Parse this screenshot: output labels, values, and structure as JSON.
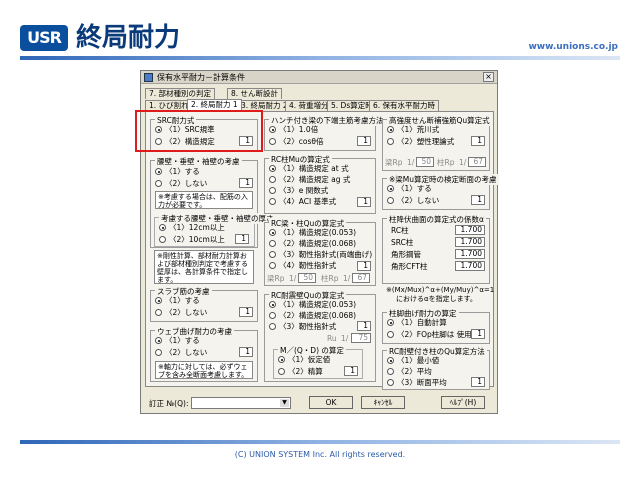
{
  "header": {
    "logo": "USR",
    "title": "終局耐力",
    "site": "www.unions.co.jp"
  },
  "footer": {
    "copyright": "(C) UNION SYSTEM Inc. All rights reserved."
  },
  "window": {
    "title": "保有水平耐力－計算条件",
    "close": "×"
  },
  "tabs_row1": [
    "7. 部材種別の判定",
    "8. せん断設計"
  ],
  "tabs_row2": [
    "1. ひび割れ",
    "2. 終局耐力 1",
    "3. 終局耐力 2",
    "4. 荷重増分",
    "5. Ds算定時",
    "6. 保有水平耐力時"
  ],
  "src": {
    "label": "SRC耐力式",
    "opt1": "〈1〉SRC規準",
    "opt2": "〈2〉構造規定",
    "val": "1"
  },
  "wall": {
    "label": "腰壁・垂壁・袖壁の考慮",
    "opt1": "〈1〉する",
    "opt2": "〈2〉しない",
    "val": "1",
    "note": "※考慮する場合は、配筋の入力が必要です。"
  },
  "thick": {
    "label": "考慮する腰壁・垂壁・袖壁の厚さ",
    "opt1": "〈1〉12cm以上",
    "opt2": "〈2〉10cm以上",
    "val": "1",
    "note": "※剛性計算、部材耐力計算および部材種別判定で考慮する壁厚は、各計算条件で指定します。"
  },
  "slab": {
    "label": "スラブ筋の考慮",
    "opt1": "〈1〉する",
    "opt2": "〈2〉しない",
    "val": "1"
  },
  "web": {
    "label": "ウェブ曲げ耐力の考慮",
    "opt1": "〈1〉する",
    "opt2": "〈2〉しない",
    "val": "1",
    "note": "※軸力に対しては、必ずウェブを含み全断面考慮します。"
  },
  "haunch": {
    "label": "ハンチ付き梁の下端主筋考慮方法",
    "opt1": "〈1〉1.0倍",
    "opt2": "〈2〉cosθ倍",
    "val": "1"
  },
  "rcmu": {
    "label": "RC柱Muの算定式",
    "opts": [
      "〈1〉構造規定 at 式",
      "〈2〉構造規定 ag 式",
      "〈3〉e 関数式",
      "〈4〉ACI 基準式"
    ],
    "val": "1"
  },
  "rcqu": {
    "label": "RC梁・柱Quの算定式",
    "opts": [
      "〈1〉構造規定(0.053)",
      "〈2〉構造規定(0.068)",
      "〈3〉靭性指針式(両端曲げ)",
      "〈4〉靭性指針式"
    ],
    "val": "1",
    "rp_label": "梁Rp",
    "rp": "50",
    "col_label": "柱Rp",
    "col": "67"
  },
  "rcwall": {
    "label": "RC耐震壁Quの算定式",
    "opts": [
      "〈1〉構造規定(0.053)",
      "〈2〉構造規定(0.068)",
      "〈3〉靭性指針式"
    ],
    "val": "1",
    "ru_label": "Ru",
    "ru": "75"
  },
  "mqd": {
    "label": "M／(Q・D) の算定",
    "opt1": "〈1〉仮定値",
    "opt2": "〈2〉精算",
    "val": "1"
  },
  "shear": {
    "label": "高強度せん断補強筋Qu算定式",
    "opt1": "〈1〉荒川式",
    "opt2": "〈2〉塑性理論式",
    "val": "1",
    "rp_label": "梁Rp",
    "rp": "50",
    "col_label": "柱Rp",
    "col": "67"
  },
  "mu_section": {
    "label": "※梁Mu算定時の検定断面の考慮",
    "opt1": "〈1〉する",
    "opt2": "〈2〉しない",
    "val": "1"
  },
  "alpha": {
    "label": "柱降伏曲面の算定式の係数α",
    "rows": [
      [
        "RC柱",
        "1.700"
      ],
      [
        "SRC柱",
        "1.700"
      ],
      [
        "角形鋼管",
        "1.700"
      ],
      [
        "角形CFT柱",
        "1.700"
      ]
    ],
    "note1": "※(Mx/Mux)^α+(My/Muy)^α=1",
    "note2": "におけるαを指定します。"
  },
  "colbend": {
    "label": "柱脚曲げ耐力の算定",
    "opt1": "〈1〉自動計算",
    "opt2": "〈2〉FOp柱脚は 使用",
    "val": "1"
  },
  "rcwallcol": {
    "label": "RC耐壁付き柱のQu算定方法",
    "opts": [
      "〈1〉最小値",
      "〈2〉平均",
      "〈3〉断面平均"
    ],
    "val": "1"
  },
  "bottom": {
    "revision_label": "訂正 №(Q):",
    "ok": "OK",
    "cancel": "ｷｬﾝｾﾙ",
    "help": "ﾍﾙﾌﾟ(H)"
  }
}
